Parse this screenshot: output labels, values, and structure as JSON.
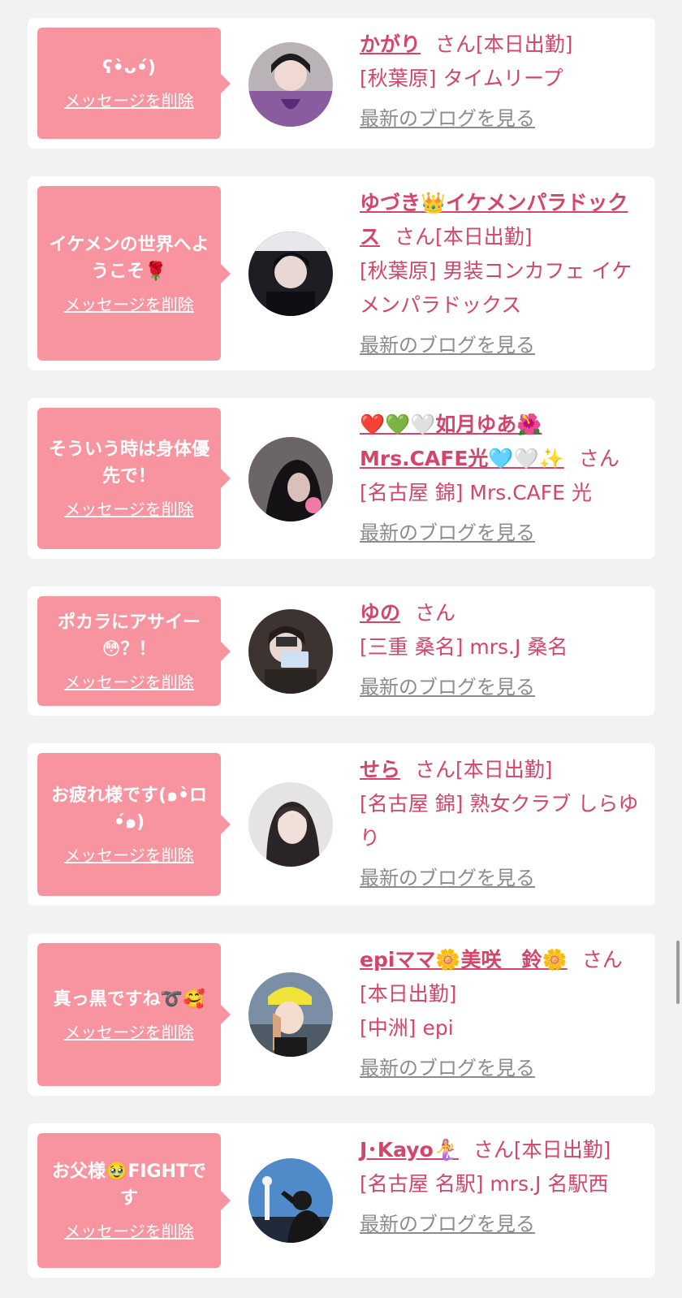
{
  "delete_label": "メッセージを削除",
  "blog_label": "最新のブログを見る",
  "san_suffix": "さん",
  "colors": {
    "accent": "#d4456a",
    "bubble": "#f7949f",
    "link_gray": "#8c8c8c",
    "background": "#f2f2f2"
  },
  "cards": [
    {
      "message": "ʕ•̀ᴗ•́)",
      "name": "かがり",
      "status": "[本日出勤]",
      "shop": "[秋葉原] タイムリープ"
    },
    {
      "message": "イケメンの世界へようこそ🌹",
      "name": "ゆづき👑イケメンパラドックス",
      "status": "[本日出勤]",
      "shop": "[秋葉原] 男装コンカフェ イケメンパラドックス"
    },
    {
      "message": "そういう時は身体優先で！",
      "name": "❤️💚🤍如月ゆあ🌺Mrs.CAFE光🩵🤍✨",
      "status": "",
      "shop": "[名古屋 錦] Mrs.CAFE 光"
    },
    {
      "message": "ポカラにアサイー😳？！",
      "name": "ゆの",
      "status": "",
      "shop": "[三重 桑名] mrs.J 桑名"
    },
    {
      "message": "お疲れ様です(๑•̀ロ•́๑)",
      "name": "せら",
      "status": "[本日出勤]",
      "shop": "[名古屋 錦] 熟女クラブ しらゆり"
    },
    {
      "message": "真っ黒ですね➰🥰",
      "name": "epiママ🌼美咲　鈴🌼",
      "status": "[本日出勤]",
      "shop": "[中洲] epi"
    },
    {
      "message": "お父様🥹FIGHTです",
      "name": "J･Kayo🧜‍♀️",
      "status": "[本日出勤]",
      "shop": "[名古屋 名駅] mrs.J 名駅西"
    }
  ]
}
